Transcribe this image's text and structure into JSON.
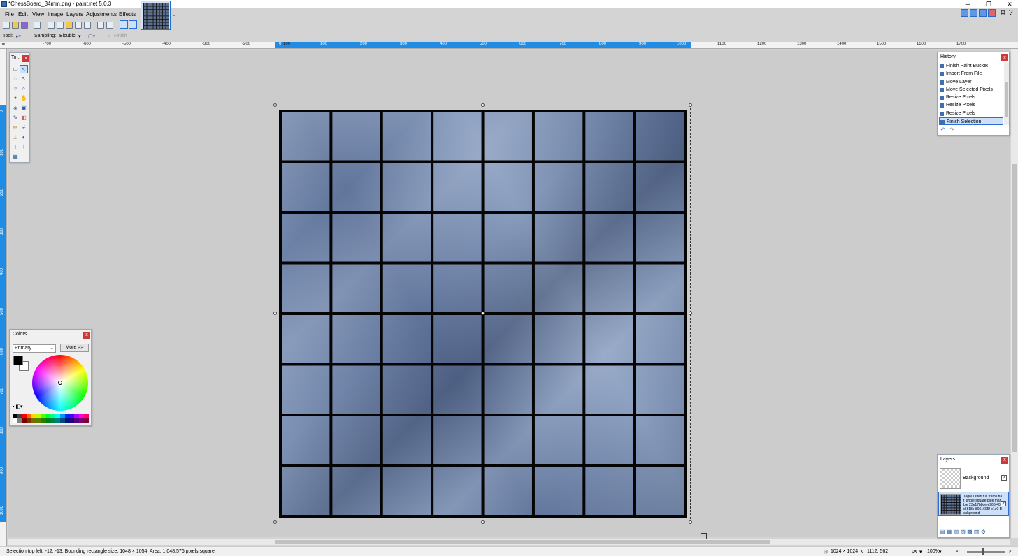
{
  "window": {
    "title": "*ChessBoard_34mm.png - paint.net 5.0.3",
    "buttons": {
      "minimize": "─",
      "restore": "❐",
      "close": "✕"
    }
  },
  "menu": [
    "File",
    "Edit",
    "View",
    "Image",
    "Layers",
    "Adjustments",
    "Effects"
  ],
  "options_bar": {
    "tool_label": "Tool:",
    "sampling_label": "Sampling:",
    "sampling_value": "Bicubic",
    "finish_label": "Finish"
  },
  "ruler": {
    "unit": "px",
    "top_labels": [
      "-700",
      "-600",
      "-500",
      "-400",
      "-300",
      "-200",
      "-100",
      "0",
      "100",
      "200",
      "300",
      "400",
      "500",
      "600",
      "700",
      "800",
      "900",
      "1000",
      "1100",
      "1200",
      "1300",
      "1400",
      "1500",
      "1600",
      "1700"
    ],
    "left_labels": [
      "0",
      "100",
      "200",
      "300",
      "400",
      "500",
      "600",
      "700",
      "800",
      "900",
      "1000"
    ]
  },
  "tools_panel": {
    "title": "To..."
  },
  "colors_panel": {
    "title": "Colors",
    "mode": "Primary",
    "more_button": "More >>",
    "primary_color": "#000000",
    "secondary_color": "#ffffff",
    "palette": [
      "#000000",
      "#404040",
      "#ff0000",
      "#ff6a00",
      "#ffd800",
      "#b6ff00",
      "#4cff00",
      "#00ff21",
      "#00ff90",
      "#00ffff",
      "#0094ff",
      "#0026ff",
      "#4800ff",
      "#b200ff",
      "#ff00dc",
      "#ff006e",
      "#ffffff",
      "#808080",
      "#7f0000",
      "#7f3300",
      "#7f6a00",
      "#5b7f00",
      "#267f00",
      "#007f0e",
      "#007f46",
      "#007f7f",
      "#004a7f",
      "#00137f",
      "#21007f",
      "#57007f",
      "#7f006e",
      "#7f0037"
    ]
  },
  "history_panel": {
    "title": "History",
    "items": [
      "Finish Paint Bucket",
      "Import From File",
      "Move Layer",
      "Move Selected Pixels",
      "Resize Pixels",
      "Resize Pixels",
      "Resize Pixels",
      "Finish Selection"
    ],
    "selected_index": 7
  },
  "layers_panel": {
    "title": "Layers",
    "layers": [
      {
        "name": "Background",
        "visible": true,
        "selected": false
      },
      {
        "name": "Tegol Taffeti full frame flat single square blue marble 23e17b8de e966-405d-818c-8061605f e1e0 Background",
        "visible": true,
        "selected": true
      }
    ]
  },
  "status_bar": {
    "selection_info": "Selection top left: -12, -13. Bounding rectangle size: 1048 × 1054. Area: 1,048,576 pixels square",
    "image_size": "1024 × 1024",
    "cursor_position": "1112, 562",
    "unit": "px",
    "zoom": "100%"
  },
  "canvas": {
    "board_rows": 8,
    "board_cols": 8,
    "board_line_color": "#050505",
    "marble_color": "#6f86ad"
  }
}
